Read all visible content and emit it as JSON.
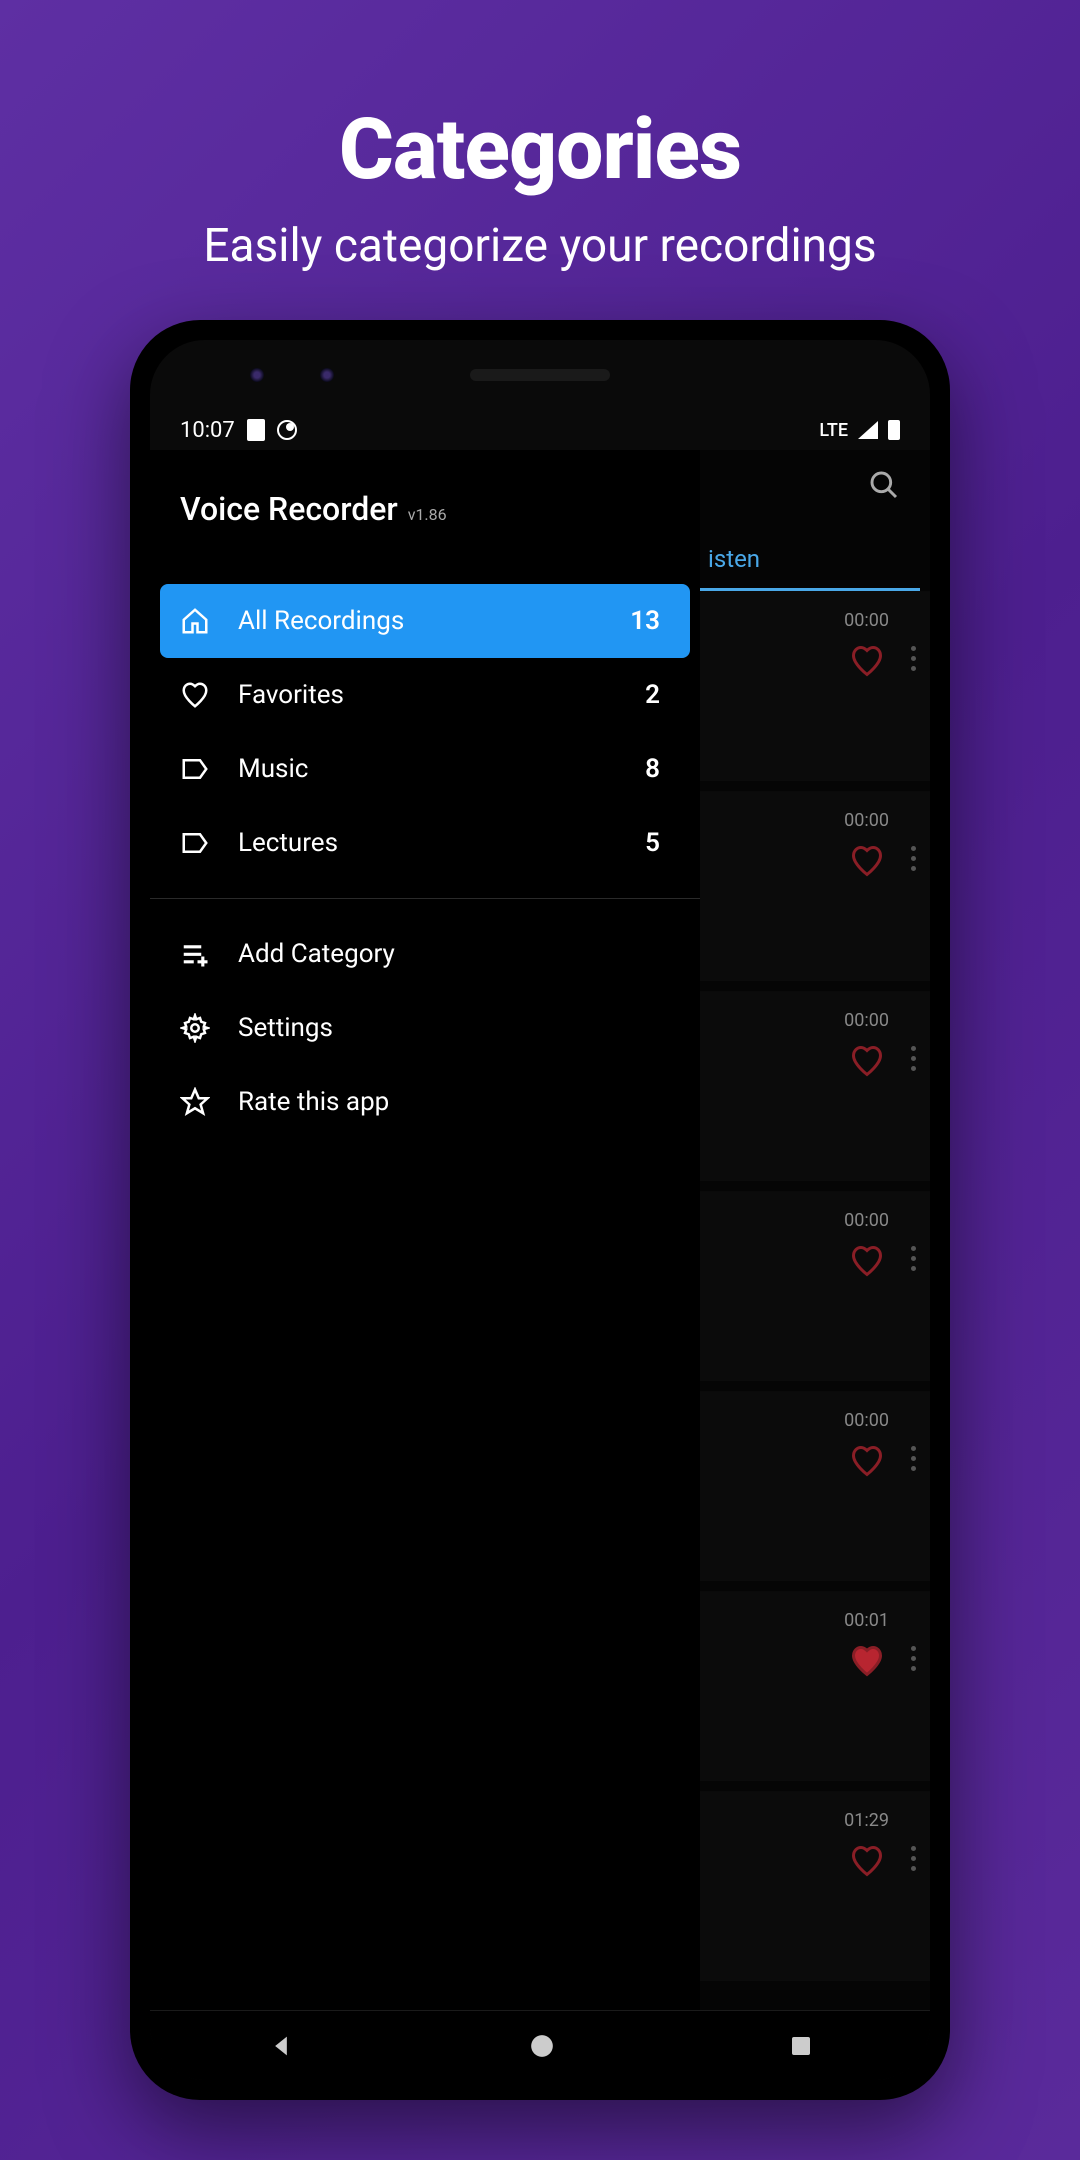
{
  "promo": {
    "title": "Categories",
    "subtitle": "Easily categorize your recordings"
  },
  "statusBar": {
    "time": "10:07",
    "network": "LTE"
  },
  "app": {
    "title": "Voice Recorder",
    "version": "v1.86"
  },
  "drawer": {
    "categories": [
      {
        "icon": "home",
        "label": "All Recordings",
        "count": "13",
        "active": true
      },
      {
        "icon": "heart",
        "label": "Favorites",
        "count": "2",
        "active": false
      },
      {
        "icon": "tag",
        "label": "Music",
        "count": "8",
        "active": false
      },
      {
        "icon": "tag",
        "label": "Lectures",
        "count": "5",
        "active": false
      }
    ],
    "actions": [
      {
        "icon": "add",
        "label": "Add Category"
      },
      {
        "icon": "settings",
        "label": "Settings"
      },
      {
        "icon": "star",
        "label": "Rate this app"
      }
    ]
  },
  "tabs": {
    "listen": "isten"
  },
  "recordings": [
    {
      "time": "00:00",
      "favorited": false
    },
    {
      "time": "00:00",
      "favorited": false
    },
    {
      "time": "00:00",
      "favorited": false
    },
    {
      "time": "00:00",
      "favorited": false
    },
    {
      "time": "00:00",
      "favorited": false
    },
    {
      "time": "00:01",
      "favorited": true
    },
    {
      "time": "01:29",
      "favorited": false
    }
  ]
}
